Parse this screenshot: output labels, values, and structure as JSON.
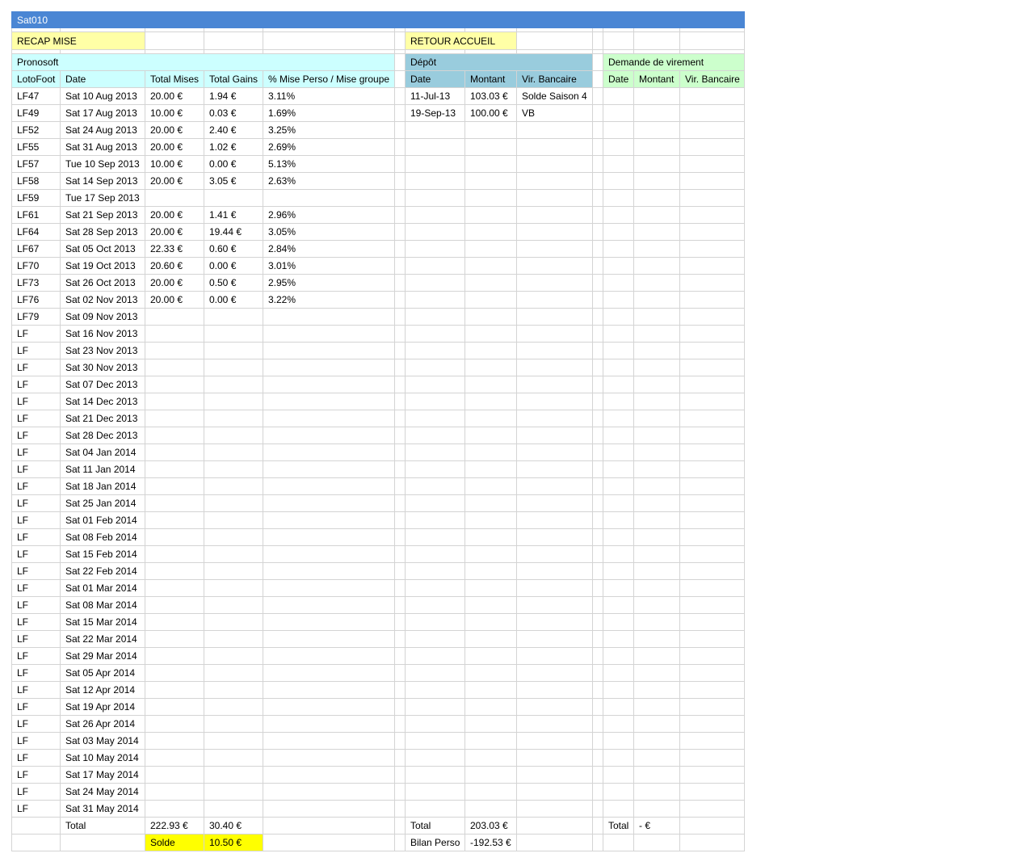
{
  "sheet": {
    "title": "Sat010",
    "recap_link": "RECAP MISE",
    "home_link": "RETOUR ACCUEIL"
  },
  "pronosoft": {
    "header": "Pronosoft",
    "columns": [
      "LotoFoot",
      "Date",
      "Total Mises",
      "Total Gains",
      "% Mise Perso / Mise groupe"
    ],
    "rows": [
      [
        "LF47",
        "Sat 10 Aug 2013",
        "20.00 €",
        "1.94 €",
        "3.11%"
      ],
      [
        "LF49",
        "Sat 17 Aug 2013",
        "10.00 €",
        "0.03 €",
        "1.69%"
      ],
      [
        "LF52",
        "Sat 24 Aug 2013",
        "20.00 €",
        "2.40 €",
        "3.25%"
      ],
      [
        "LF55",
        "Sat 31 Aug 2013",
        "20.00 €",
        "1.02 €",
        "2.69%"
      ],
      [
        "LF57",
        "Tue 10 Sep 2013",
        "10.00 €",
        "0.00 €",
        "5.13%"
      ],
      [
        "LF58",
        "Sat 14 Sep 2013",
        "20.00 €",
        "3.05 €",
        "2.63%"
      ],
      [
        "LF59",
        "Tue 17 Sep 2013",
        "",
        "",
        ""
      ],
      [
        "LF61",
        "Sat 21 Sep 2013",
        "20.00 €",
        "1.41 €",
        "2.96%"
      ],
      [
        "LF64",
        "Sat 28 Sep 2013",
        "20.00 €",
        "19.44 €",
        "3.05%"
      ],
      [
        "LF67",
        "Sat 05 Oct 2013",
        "22.33 €",
        "0.60 €",
        "2.84%"
      ],
      [
        "LF70",
        "Sat 19 Oct 2013",
        "20.60 €",
        "0.00 €",
        "3.01%"
      ],
      [
        "LF73",
        "Sat 26 Oct 2013",
        "20.00 €",
        "0.50 €",
        "2.95%"
      ],
      [
        "LF76",
        "Sat 02 Nov 2013",
        "20.00 €",
        "0.00 €",
        "3.22%"
      ],
      [
        "LF79",
        "Sat 09 Nov 2013",
        "",
        "",
        ""
      ],
      [
        "LF",
        "Sat 16 Nov 2013",
        "",
        "",
        ""
      ],
      [
        "LF",
        "Sat 23 Nov 2013",
        "",
        "",
        ""
      ],
      [
        "LF",
        "Sat 30 Nov 2013",
        "",
        "",
        ""
      ],
      [
        "LF",
        "Sat 07 Dec 2013",
        "",
        "",
        ""
      ],
      [
        "LF",
        "Sat 14 Dec 2013",
        "",
        "",
        ""
      ],
      [
        "LF",
        "Sat 21 Dec 2013",
        "",
        "",
        ""
      ],
      [
        "LF",
        "Sat 28 Dec 2013",
        "",
        "",
        ""
      ],
      [
        "LF",
        "Sat 04 Jan 2014",
        "",
        "",
        ""
      ],
      [
        "LF",
        "Sat 11 Jan 2014",
        "",
        "",
        ""
      ],
      [
        "LF",
        "Sat 18 Jan 2014",
        "",
        "",
        ""
      ],
      [
        "LF",
        "Sat 25 Jan 2014",
        "",
        "",
        ""
      ],
      [
        "LF",
        "Sat 01 Feb 2014",
        "",
        "",
        ""
      ],
      [
        "LF",
        "Sat 08 Feb 2014",
        "",
        "",
        ""
      ],
      [
        "LF",
        "Sat 15 Feb 2014",
        "",
        "",
        ""
      ],
      [
        "LF",
        "Sat 22 Feb 2014",
        "",
        "",
        ""
      ],
      [
        "LF",
        "Sat 01 Mar 2014",
        "",
        "",
        ""
      ],
      [
        "LF",
        "Sat 08 Mar 2014",
        "",
        "",
        ""
      ],
      [
        "LF",
        "Sat 15 Mar 2014",
        "",
        "",
        ""
      ],
      [
        "LF",
        "Sat 22 Mar 2014",
        "",
        "",
        ""
      ],
      [
        "LF",
        "Sat 29 Mar 2014",
        "",
        "",
        ""
      ],
      [
        "LF",
        "Sat 05 Apr 2014",
        "",
        "",
        ""
      ],
      [
        "LF",
        "Sat 12 Apr 2014",
        "",
        "",
        ""
      ],
      [
        "LF",
        "Sat 19 Apr 2014",
        "",
        "",
        ""
      ],
      [
        "LF",
        "Sat 26 Apr 2014",
        "",
        "",
        ""
      ],
      [
        "LF",
        "Sat 03 May 2014",
        "",
        "",
        ""
      ],
      [
        "LF",
        "Sat 10 May 2014",
        "",
        "",
        ""
      ],
      [
        "LF",
        "Sat 17 May 2014",
        "",
        "",
        ""
      ],
      [
        "LF",
        "Sat 24 May 2014",
        "",
        "",
        ""
      ],
      [
        "LF",
        "Sat 31 May 2014",
        "",
        "",
        ""
      ]
    ],
    "total_label": "Total",
    "total_mises": "222.93 €",
    "total_gains": "30.40 €",
    "solde_label": "Solde",
    "solde_value": "10.50 €"
  },
  "depot": {
    "header": "Dépôt",
    "columns": [
      "Date",
      "Montant",
      "Vir. Bancaire"
    ],
    "rows": [
      [
        "11-Jul-13",
        "103.03 €",
        "Solde Saison 4"
      ],
      [
        "19-Sep-13",
        "100.00 €",
        "VB"
      ]
    ],
    "total_label": "Total",
    "total_value": "203.03 €",
    "bilan_label": "Bilan Perso",
    "bilan_value": "-192.53 €"
  },
  "virement": {
    "header": "Demande de virement",
    "columns": [
      "Date",
      "Montant",
      "Vir. Bancaire"
    ],
    "rows": [],
    "total_label": "Total",
    "total_value": "- €"
  },
  "colors": {
    "title_bar": "#4a86d4",
    "yellow_link": "#ffffa6",
    "pronosoft_header": "#ccffff",
    "depot_header": "#99ccdd",
    "virement_header": "#ccffcc",
    "solde_highlight": "#ffff00",
    "grid": "#d4d4d4"
  }
}
